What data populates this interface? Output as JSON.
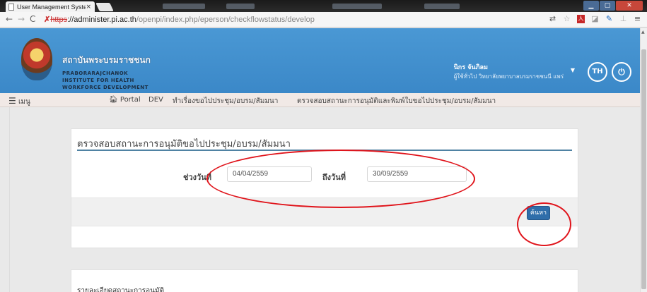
{
  "browser": {
    "tab_title": "User Management System",
    "tab_close": "×",
    "url_scheme": "https",
    "url_host": "://administer.pi.ac.th",
    "url_path": "/openpi/index.php/eperson/checkflowstatus/develop"
  },
  "header": {
    "org_name_th": "สถาบันพระบรมราชชนก",
    "org_name_en": [
      "PRABORARAJCHANOK",
      "INSTITUTE FOR HEALTH",
      "WORKFORCE DEVELOPMENT"
    ],
    "user_name": "นิกร จันภิลม",
    "user_role": "ผู้ใช้ทั่วไป วิทยาลัยพยาบาลบรมราชชนนี แพร่",
    "lang_label": "TH"
  },
  "menu": {
    "toggle_label": "เมนู",
    "portal_label": "Portal",
    "dev_label": "DEV",
    "item_request": "ทำเรื่องขอไปประชุม/อบรม/สัมมนา",
    "item_check": "ตรวจสอบสถานะการอนุมัติและพิมพ์ใบขอไปประชุม/อบรม/สัมมนา"
  },
  "form": {
    "title": "ตรวจสอบสถานะการอนุมัติขอไปประชุม/อบรม/สัมมนา",
    "from_label": "ช่วงวันที่",
    "from_value": "04/04/2559",
    "to_label": "ถึงวันที่",
    "to_value": "30/09/2559",
    "search_label": "ค้นหา"
  },
  "details": {
    "title": "รายละเอียดสถานะการอนุมัติ"
  }
}
